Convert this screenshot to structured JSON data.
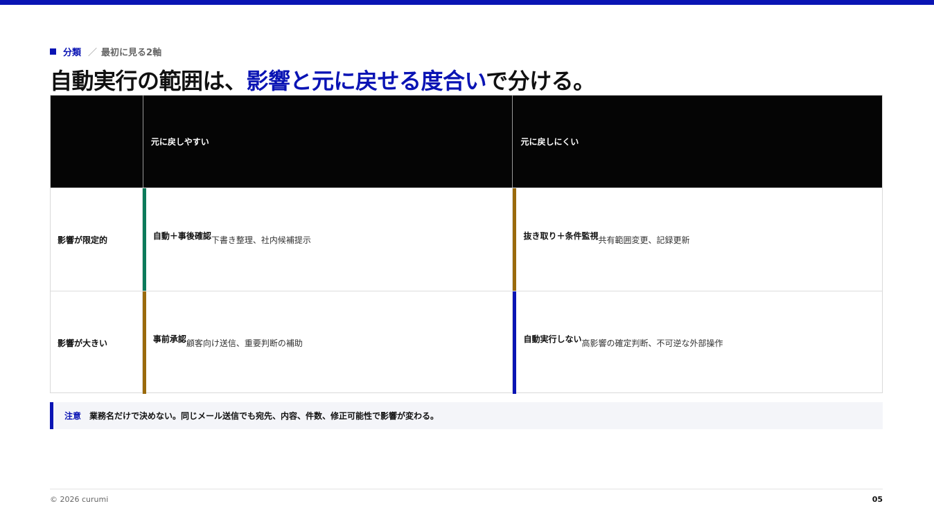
{
  "eyebrow": {
    "section": "分類",
    "separator": "／",
    "sub": "最初に見る2軸"
  },
  "headline": {
    "prefix": "自動実行の範囲は、",
    "accent": "影響と元に戻せる度合い",
    "suffix": "で分ける。"
  },
  "matrix": {
    "columns": [
      "元に戻しやすい",
      "元に戻しにくい"
    ],
    "rows": [
      {
        "label": "影響が限定的",
        "cells": [
          {
            "title": "自動＋事後確認",
            "detail": "下書き整理、社内候補提示"
          },
          {
            "title": "抜き取り＋条件監視",
            "detail": "共有範囲変更、記録更新"
          }
        ]
      },
      {
        "label": "影響が大きい",
        "cells": [
          {
            "title": "事前承認",
            "detail": "顧客向け送信、重要判断の補助"
          },
          {
            "title": "自動実行しない",
            "detail": "高影響の確定判断、不可逆な外部操作"
          }
        ]
      }
    ]
  },
  "note": {
    "tag": "注意",
    "text": "業務名だけで決めない。同じメール送信でも宛先、内容、件数、修正可能性で影響が変わる。"
  },
  "footer": {
    "copyright": "© 2026 curumi",
    "page": "05"
  },
  "colors": {
    "accent": "#0a14b4",
    "green": "#0c7a5a",
    "amber": "#9a6a0c",
    "blue": "#0a14b4",
    "header_bg": "#050505"
  }
}
